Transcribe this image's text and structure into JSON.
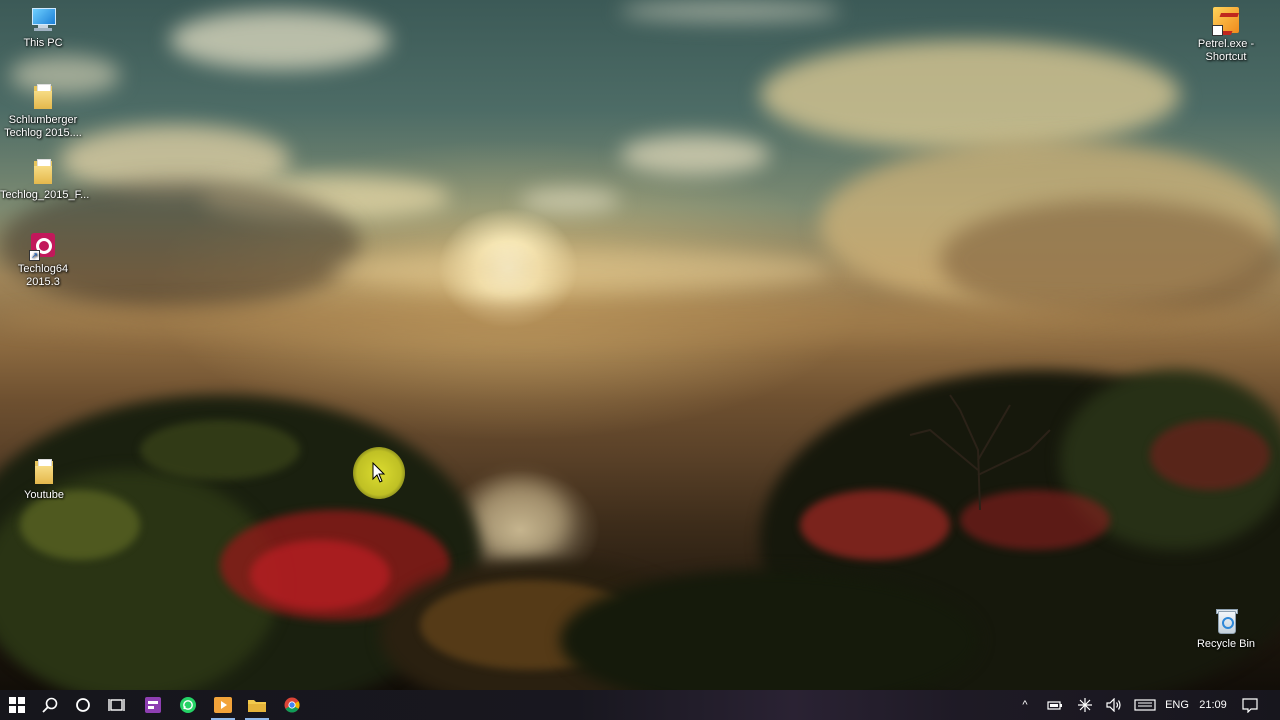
{
  "desktop_icons": {
    "this_pc": "This PC",
    "schlumberger": "Schlumberger Techlog 2015....",
    "techlog_folder": "Techlog_2015_F...",
    "techlog64": "Techlog64 2015.3",
    "youtube": "Youtube",
    "petrel": "Petrel.exe - Shortcut",
    "recycle_bin": "Recycle Bin"
  },
  "taskbar": {
    "pinned": [
      "start-icon",
      "search-icon",
      "cortana-icon",
      "task-view-icon",
      "visual-studio-icon",
      "whatsapp-icon",
      "media-player-icon",
      "file-explorer-icon",
      "chrome-icon"
    ],
    "tray": {
      "chevron": "^",
      "language": "ENG",
      "time": "21:09"
    }
  },
  "colors": {
    "taskbar": "#17161d",
    "cursor_highlight": "#e6e632",
    "whatsapp": "#25d366",
    "folder": "#e6c45c"
  }
}
